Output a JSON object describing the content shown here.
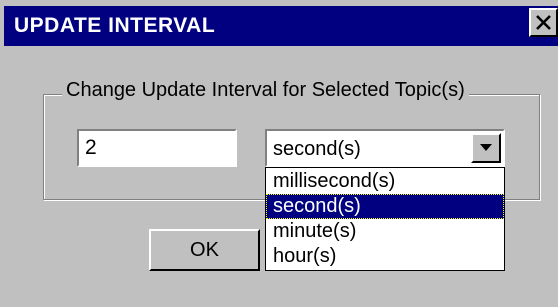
{
  "dialog": {
    "title": "UPDATE INTERVAL",
    "close_icon": "close-icon",
    "group_label": "Change Update Interval for Selected Topic(s)",
    "interval_value": "2",
    "unit_selected": "second(s)",
    "dropdown_icon": "chevron-down-icon",
    "unit_options": [
      "millisecond(s)",
      "second(s)",
      "minute(s)",
      "hour(s)"
    ],
    "highlighted_option": "second(s)",
    "ok_label": "OK"
  },
  "colors": {
    "titlebar": "#000080",
    "face": "#c0c0c0",
    "selection": "#000080"
  }
}
